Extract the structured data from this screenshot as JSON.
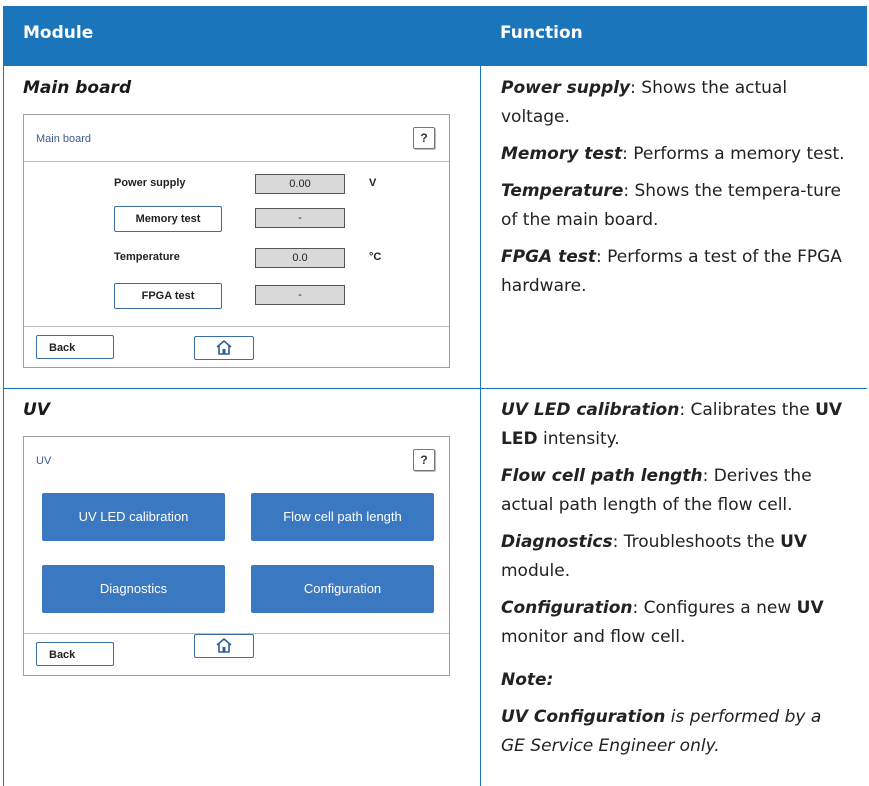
{
  "header": {
    "col_module": "Module",
    "col_function": "Function"
  },
  "rows": [
    {
      "module_title": "Main board",
      "screen": {
        "title": "Main board",
        "help_label": "?",
        "power_supply_label": "Power supply",
        "power_supply_value": "0.00",
        "power_supply_unit": "V",
        "memory_test_label": "Memory test",
        "memory_test_value": "-",
        "temperature_label": "Temperature",
        "temperature_value": "0.0",
        "temperature_unit": "°C",
        "fpga_test_label": "FPGA test",
        "fpga_test_value": "-",
        "back_label": "Back"
      },
      "functions": [
        {
          "term": "Power supply",
          "text": ": Shows the actual voltage."
        },
        {
          "term": "Memory test",
          "text": ": Performs a memory test."
        },
        {
          "term": "Temperature",
          "text": ": Shows the tempera-ture of the main board."
        },
        {
          "term": "FPGA test",
          "text": ": Performs a test of the FPGA hardware."
        }
      ]
    },
    {
      "module_title": "UV",
      "screen": {
        "title": "UV",
        "help_label": "?",
        "uv_led_calibration_label": "UV LED calibration",
        "flow_cell_path_length_label": "Flow cell path length",
        "diagnostics_label": "Diagnostics",
        "configuration_label": "Configuration",
        "back_label": "Back"
      },
      "functions": {
        "uv_led": {
          "term": "UV LED calibration",
          "text1": ": Calibrates the ",
          "strong": "UV LED",
          "text2": " intensity."
        },
        "flow_cell": {
          "term": "Flow cell path length",
          "text": ": Derives the actual path length of the flow cell."
        },
        "diagnostics": {
          "term": "Diagnostics",
          "text1": ": Troubleshoots the ",
          "strong": "UV",
          "text2": " module."
        },
        "configuration": {
          "term": "Configuration",
          "text1": ": Configures a new ",
          "strong": "UV",
          "text2": " monitor and flow cell."
        }
      },
      "note": {
        "heading": "Note:",
        "term": "UV Configuration",
        "text": " is performed by a GE Service Engineer only."
      }
    }
  ],
  "colors": {
    "header_bg": "#1b75bb",
    "button_blue": "#3a79c1",
    "rule": "#1b75bb"
  },
  "icons": [
    "home-icon",
    "help-icon"
  ]
}
